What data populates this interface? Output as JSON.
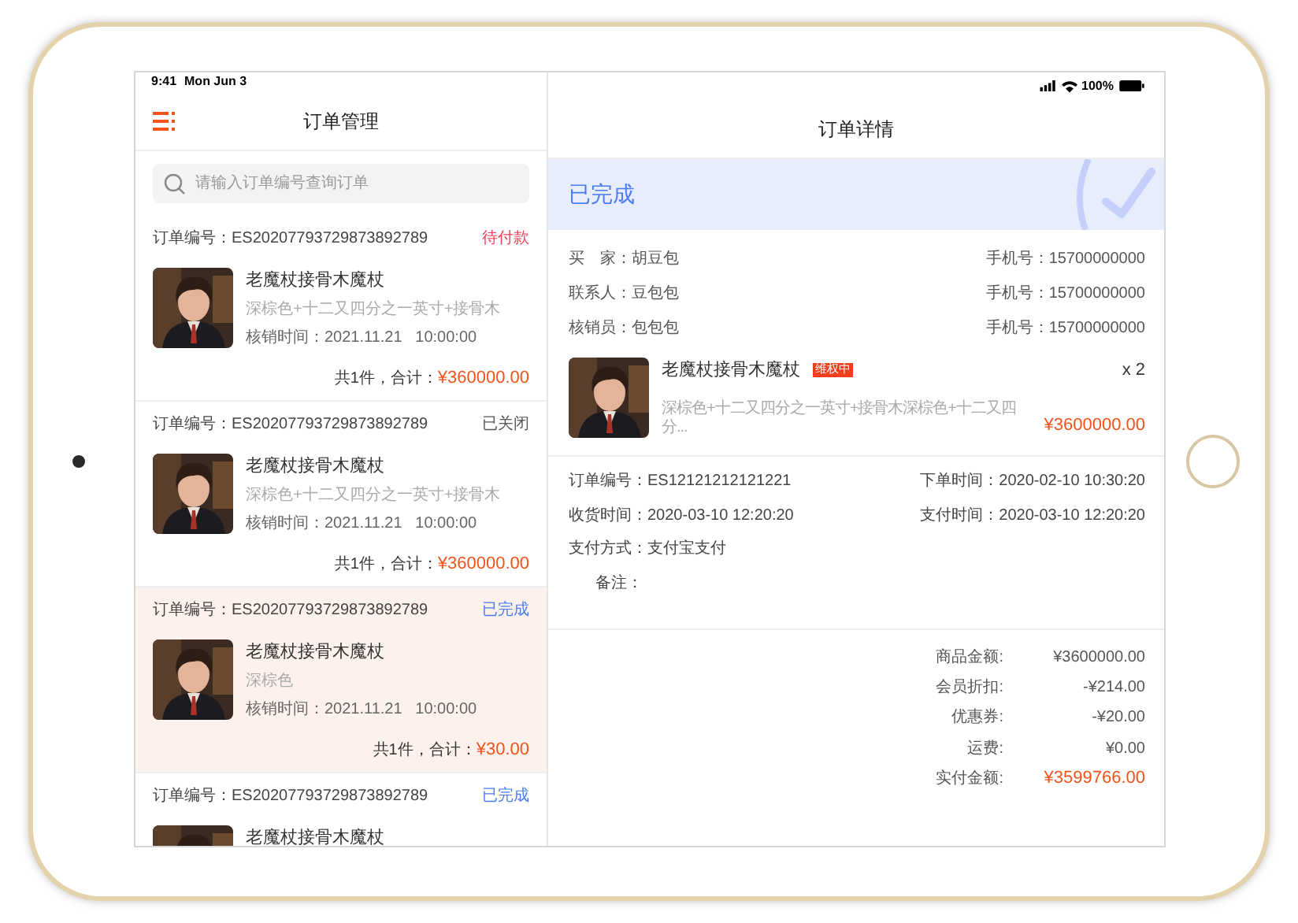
{
  "status_bar": {
    "time": "9:41",
    "date": "Mon Jun 3",
    "battery": "100%"
  },
  "list_pane": {
    "title": "订单管理",
    "search": {
      "placeholder": "请输入订单编号查询订单"
    },
    "orders": [
      {
        "number": "订单编号：ES20207793729873892789",
        "status": "待付款",
        "color": "#f0425a",
        "name": "老魔杖接骨木魔杖",
        "spec": "深棕色+十二又四分之一英寸+接骨木",
        "time": "核销时间：2021.11.21   10:00:00",
        "total_label": "共1件，合计：",
        "total": "¥360000.00",
        "selected": false
      },
      {
        "number": "订单编号：ES20207793729873892789",
        "status": "已关闭",
        "color": "#555555",
        "name": "老魔杖接骨木魔杖",
        "spec": "深棕色+十二又四分之一英寸+接骨木",
        "time": "核销时间：2021.11.21   10:00:00",
        "total_label": "共1件，合计：",
        "total": "¥360000.00",
        "selected": false
      },
      {
        "number": "订单编号：ES20207793729873892789",
        "status": "已完成",
        "color": "#4a7cf6",
        "name": "老魔杖接骨木魔杖",
        "spec": "深棕色",
        "time": "核销时间：2021.11.21   10:00:00",
        "total_label": "共1件，合计：",
        "total": "¥30.00",
        "selected": true
      },
      {
        "number": "订单编号：ES20207793729873892789",
        "status": "已完成",
        "color": "#4a7cf6",
        "name": "老魔杖接骨木魔杖",
        "selected": false
      }
    ]
  },
  "detail_pane": {
    "title": "订单详情",
    "banner": {
      "status": "已完成"
    },
    "parties": [
      {
        "label": "买　家：胡豆包",
        "phone": "手机号：15700000000"
      },
      {
        "label": "联系人：豆包包",
        "phone": "手机号：15700000000"
      },
      {
        "label": "核销员：包包包",
        "phone": "手机号：15700000000"
      }
    ],
    "product": {
      "name": "老魔杖接骨木魔杖",
      "tag": "维权中",
      "quantity": "x 2",
      "spec": "深棕色+十二又四分之一英寸+接骨木深棕色+十二又四分...",
      "price": "¥3600000.00"
    },
    "info": [
      {
        "left": "订单编号：ES12121212121221",
        "right": "下单时间：2020-02-10 10:30:20"
      },
      {
        "left": "收货时间：2020-03-10 12:20:20",
        "right": "支付时间：2020-03-10 12:20:20"
      },
      {
        "left": "支付方式：支付宝支付"
      },
      {
        "left": "备注："
      }
    ],
    "summary": [
      {
        "label": "商品金额:",
        "value": "¥3600000.00",
        "highlight": false
      },
      {
        "label": "会员折扣:",
        "value": "-¥214.00",
        "highlight": false
      },
      {
        "label": "优惠券:",
        "value": "-¥20.00",
        "highlight": false
      },
      {
        "label": "运费:",
        "value": "¥0.00",
        "highlight": false
      },
      {
        "label": "实付金额:",
        "value": "¥3599766.00",
        "highlight": true
      }
    ]
  }
}
